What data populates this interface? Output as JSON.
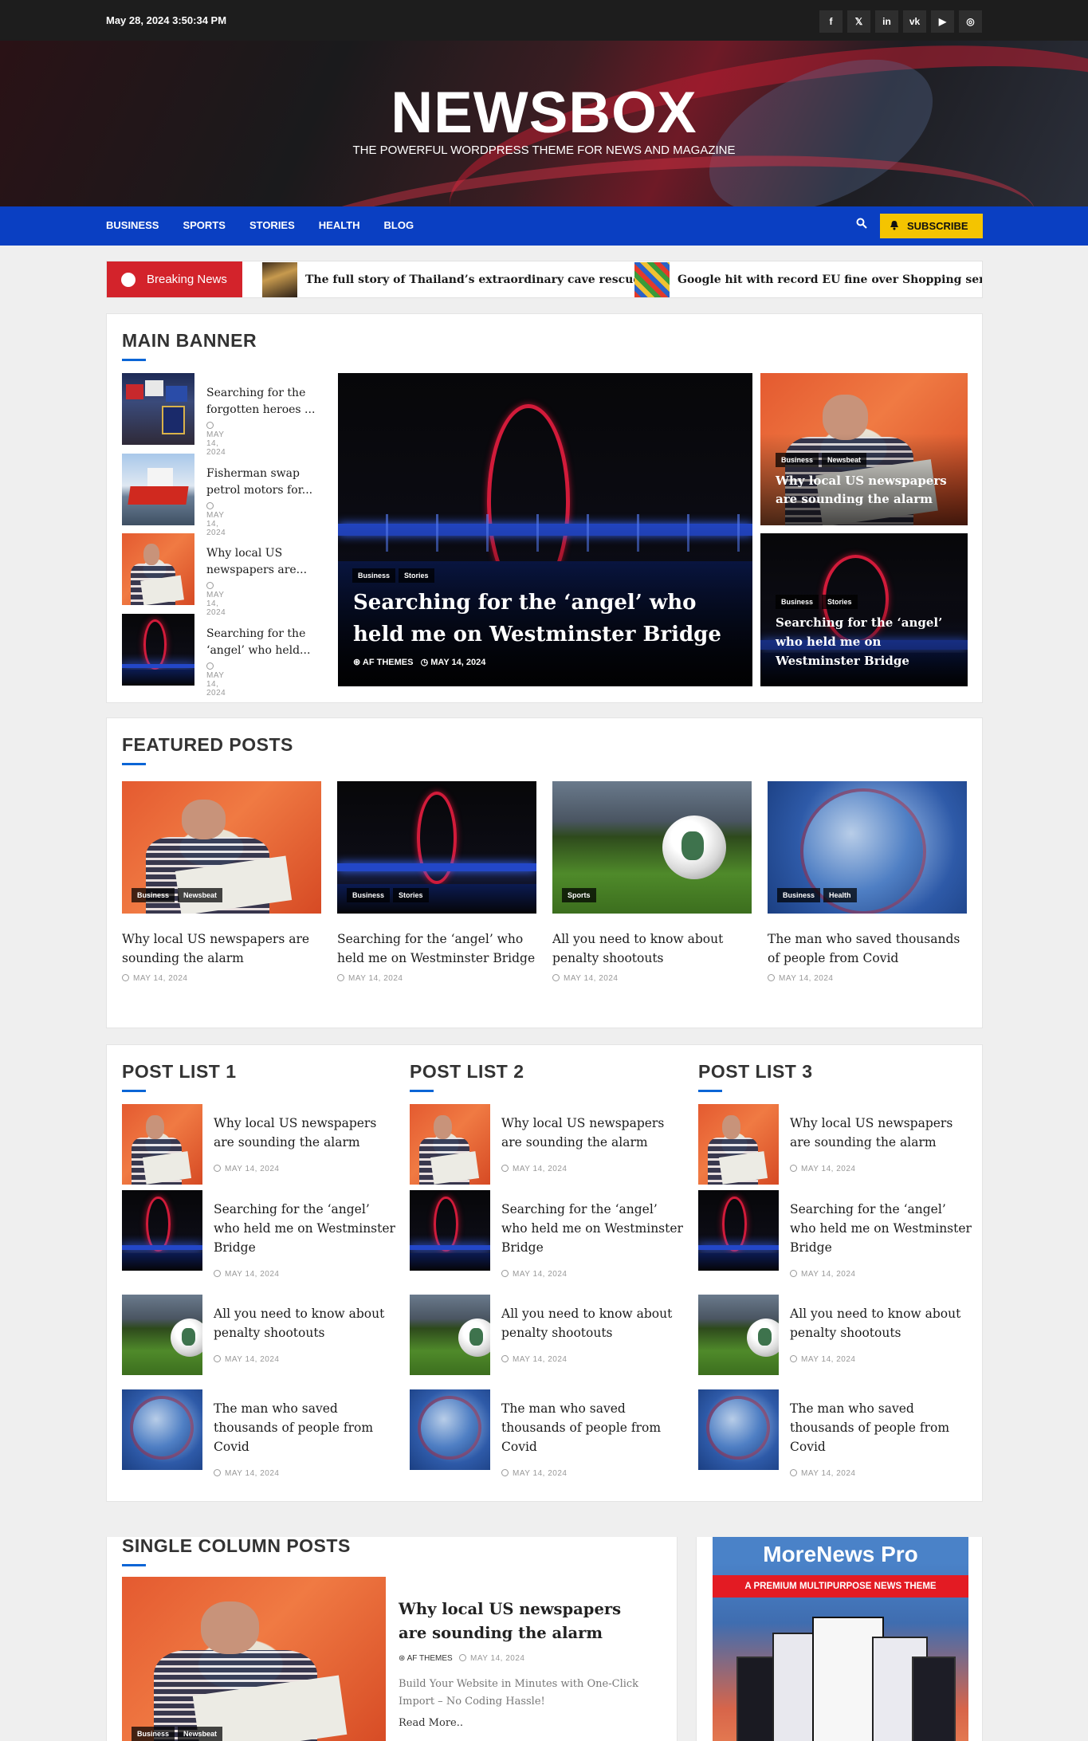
{
  "topbar": {
    "datetime": "May 28, 2024 3:50:34 PM",
    "social_icons": [
      "facebook-icon",
      "x-icon",
      "linkedin-icon",
      "vk-icon",
      "youtube-icon",
      "instagram-icon"
    ],
    "social_glyphs": [
      "f",
      "𝕏",
      "in",
      "vk",
      "▶",
      "◎"
    ]
  },
  "header": {
    "logo": "NEWSBOX",
    "tagline": "THE POWERFUL WORDPRESS THEME FOR NEWS AND MAGAZINE"
  },
  "nav": {
    "items": [
      "BUSINESS",
      "SPORTS",
      "STORIES",
      "HEALTH",
      "BLOG"
    ],
    "subscribe": "SUBSCRIBE"
  },
  "breaking": {
    "label": "Breaking News",
    "items": [
      "The full story of Thailand’s extraordinary cave rescue",
      "Google hit with record EU fine over Shopping service"
    ]
  },
  "main_banner": {
    "title": "MAIN BANNER",
    "list": [
      {
        "title": "Searching for the forgotten heroes ...",
        "date": "MAY 14, 2024"
      },
      {
        "title": "Fisherman swap petrol motors for...",
        "date": "MAY 14, 2024"
      },
      {
        "title": "Why local US newspapers are...",
        "date": "MAY 14, 2024"
      },
      {
        "title": "Searching for the ‘angel’ who held...",
        "date": "MAY 14, 2024"
      }
    ],
    "feature": {
      "tags": [
        "Business",
        "Stories"
      ],
      "title": "Searching for the ‘angel’ who held me on Westminster Bridge",
      "author": "AF THEMES",
      "date": "MAY 14, 2024"
    },
    "side": [
      {
        "tags": [
          "Business",
          "Newsbeat"
        ],
        "title": "Why local US newspapers are sounding the alarm"
      },
      {
        "tags": [
          "Business",
          "Stories"
        ],
        "title": "Searching for the ‘angel’ who held me on Westminster Bridge"
      }
    ]
  },
  "featured": {
    "title": "FEATURED POSTS",
    "posts": [
      {
        "tags": [
          "Business",
          "Newsbeat"
        ],
        "title": "Why local US newspapers are sounding the alarm",
        "date": "MAY 14, 2024"
      },
      {
        "tags": [
          "Business",
          "Stories"
        ],
        "title": "Searching for the ‘angel’ who held me on Westminster Bridge",
        "date": "MAY 14, 2024"
      },
      {
        "tags": [
          "Sports"
        ],
        "title": "All you need to know about penalty shootouts",
        "date": "MAY 14, 2024"
      },
      {
        "tags": [
          "Business",
          "Health"
        ],
        "title": "The man who saved thousands of people from Covid",
        "date": "MAY 14, 2024"
      }
    ]
  },
  "post_lists": {
    "titles": [
      "POST LIST 1",
      "POST LIST 2",
      "POST LIST 3"
    ],
    "items": [
      {
        "title": "Why local US newspapers are sounding the alarm",
        "date": "MAY 14, 2024"
      },
      {
        "title": "Searching for the ‘angel’ who held me on Westminster Bridge",
        "date": "MAY 14, 2024"
      },
      {
        "title": "All you need to know about penalty shootouts",
        "date": "MAY 14, 2024"
      },
      {
        "title": "The man who saved thousands of people from Covid",
        "date": "MAY 14, 2024"
      }
    ]
  },
  "single_column": {
    "title": "SINGLE COLUMN POSTS",
    "post": {
      "tags": [
        "Business",
        "Newsbeat"
      ],
      "title": "Why local US newspapers are sounding the alarm",
      "author": "AF THEMES",
      "date": "MAY 14, 2024",
      "excerpt": "Build Your Website in Minutes with One-Click Import – No Coding Hassle!",
      "read_more": "Read More.."
    }
  },
  "promo": {
    "title": "MoreNews Pro",
    "subtitle": "A PREMIUM MULTIPURPOSE NEWS THEME"
  },
  "colors": {
    "nav": "#0a3fc2",
    "breaking": "#d3232b",
    "subscribe": "#f4c400",
    "accent": "#0a65d6"
  }
}
